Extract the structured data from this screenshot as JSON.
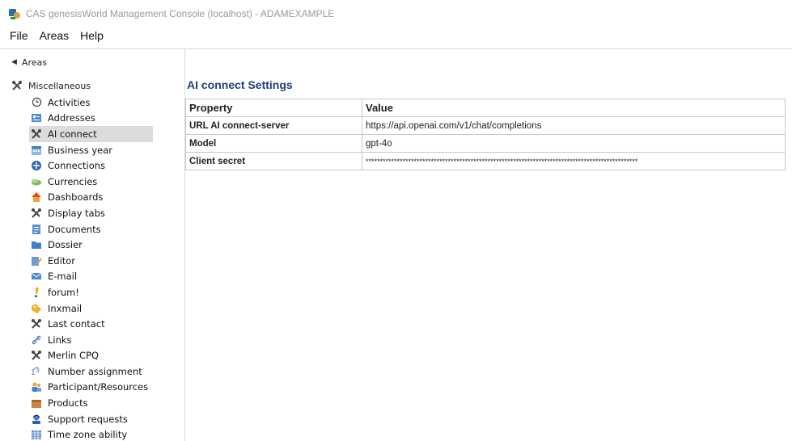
{
  "window": {
    "title": "CAS genesisWorld Management Console (localhost) - ADAMEXAMPLE"
  },
  "menu": [
    "File",
    "Areas",
    "Help"
  ],
  "areas_toggle": {
    "label": "Areas"
  },
  "tree": {
    "root": "Miscellaneous",
    "items": [
      {
        "label": "Activities",
        "icon": "clock-icon"
      },
      {
        "label": "Addresses",
        "icon": "address-card-icon"
      },
      {
        "label": "AI connect",
        "icon": "tools-icon",
        "selected": true
      },
      {
        "label": "Business year",
        "icon": "calendar-icon"
      },
      {
        "label": "Connections",
        "icon": "connections-icon"
      },
      {
        "label": "Currencies",
        "icon": "money-icon"
      },
      {
        "label": "Dashboards",
        "icon": "house-icon"
      },
      {
        "label": "Display tabs",
        "icon": "tools-icon"
      },
      {
        "label": "Documents",
        "icon": "document-icon"
      },
      {
        "label": "Dossier",
        "icon": "folder-icon"
      },
      {
        "label": "Editor",
        "icon": "editor-icon"
      },
      {
        "label": "E-mail",
        "icon": "envelope-icon"
      },
      {
        "label": "forum!",
        "icon": "exclamation-icon"
      },
      {
        "label": "Inxmail",
        "icon": "tag-icon"
      },
      {
        "label": "Last contact",
        "icon": "tools-icon"
      },
      {
        "label": "Links",
        "icon": "link-icon"
      },
      {
        "label": "Merlin CPQ",
        "icon": "tools-icon"
      },
      {
        "label": "Number assignment",
        "icon": "number-icon"
      },
      {
        "label": "Participant/Resources",
        "icon": "people-icon"
      },
      {
        "label": "Products",
        "icon": "box-icon"
      },
      {
        "label": "Support requests",
        "icon": "support-icon"
      },
      {
        "label": "Time zone ability",
        "icon": "table-icon"
      }
    ]
  },
  "settings": {
    "title": "AI connect Settings",
    "columns": [
      "Property",
      "Value"
    ],
    "rows": [
      {
        "property": "URL AI connect-server",
        "value": "https://api.openai.com/v1/chat/completions"
      },
      {
        "property": "Model",
        "value": "gpt-4o"
      },
      {
        "property": "Client secret",
        "value": "************************************************************************************************"
      }
    ]
  },
  "colors": {
    "title_blue": "#1f3f7a",
    "selection": "#dcdcdc",
    "border": "#c8c8c8"
  }
}
